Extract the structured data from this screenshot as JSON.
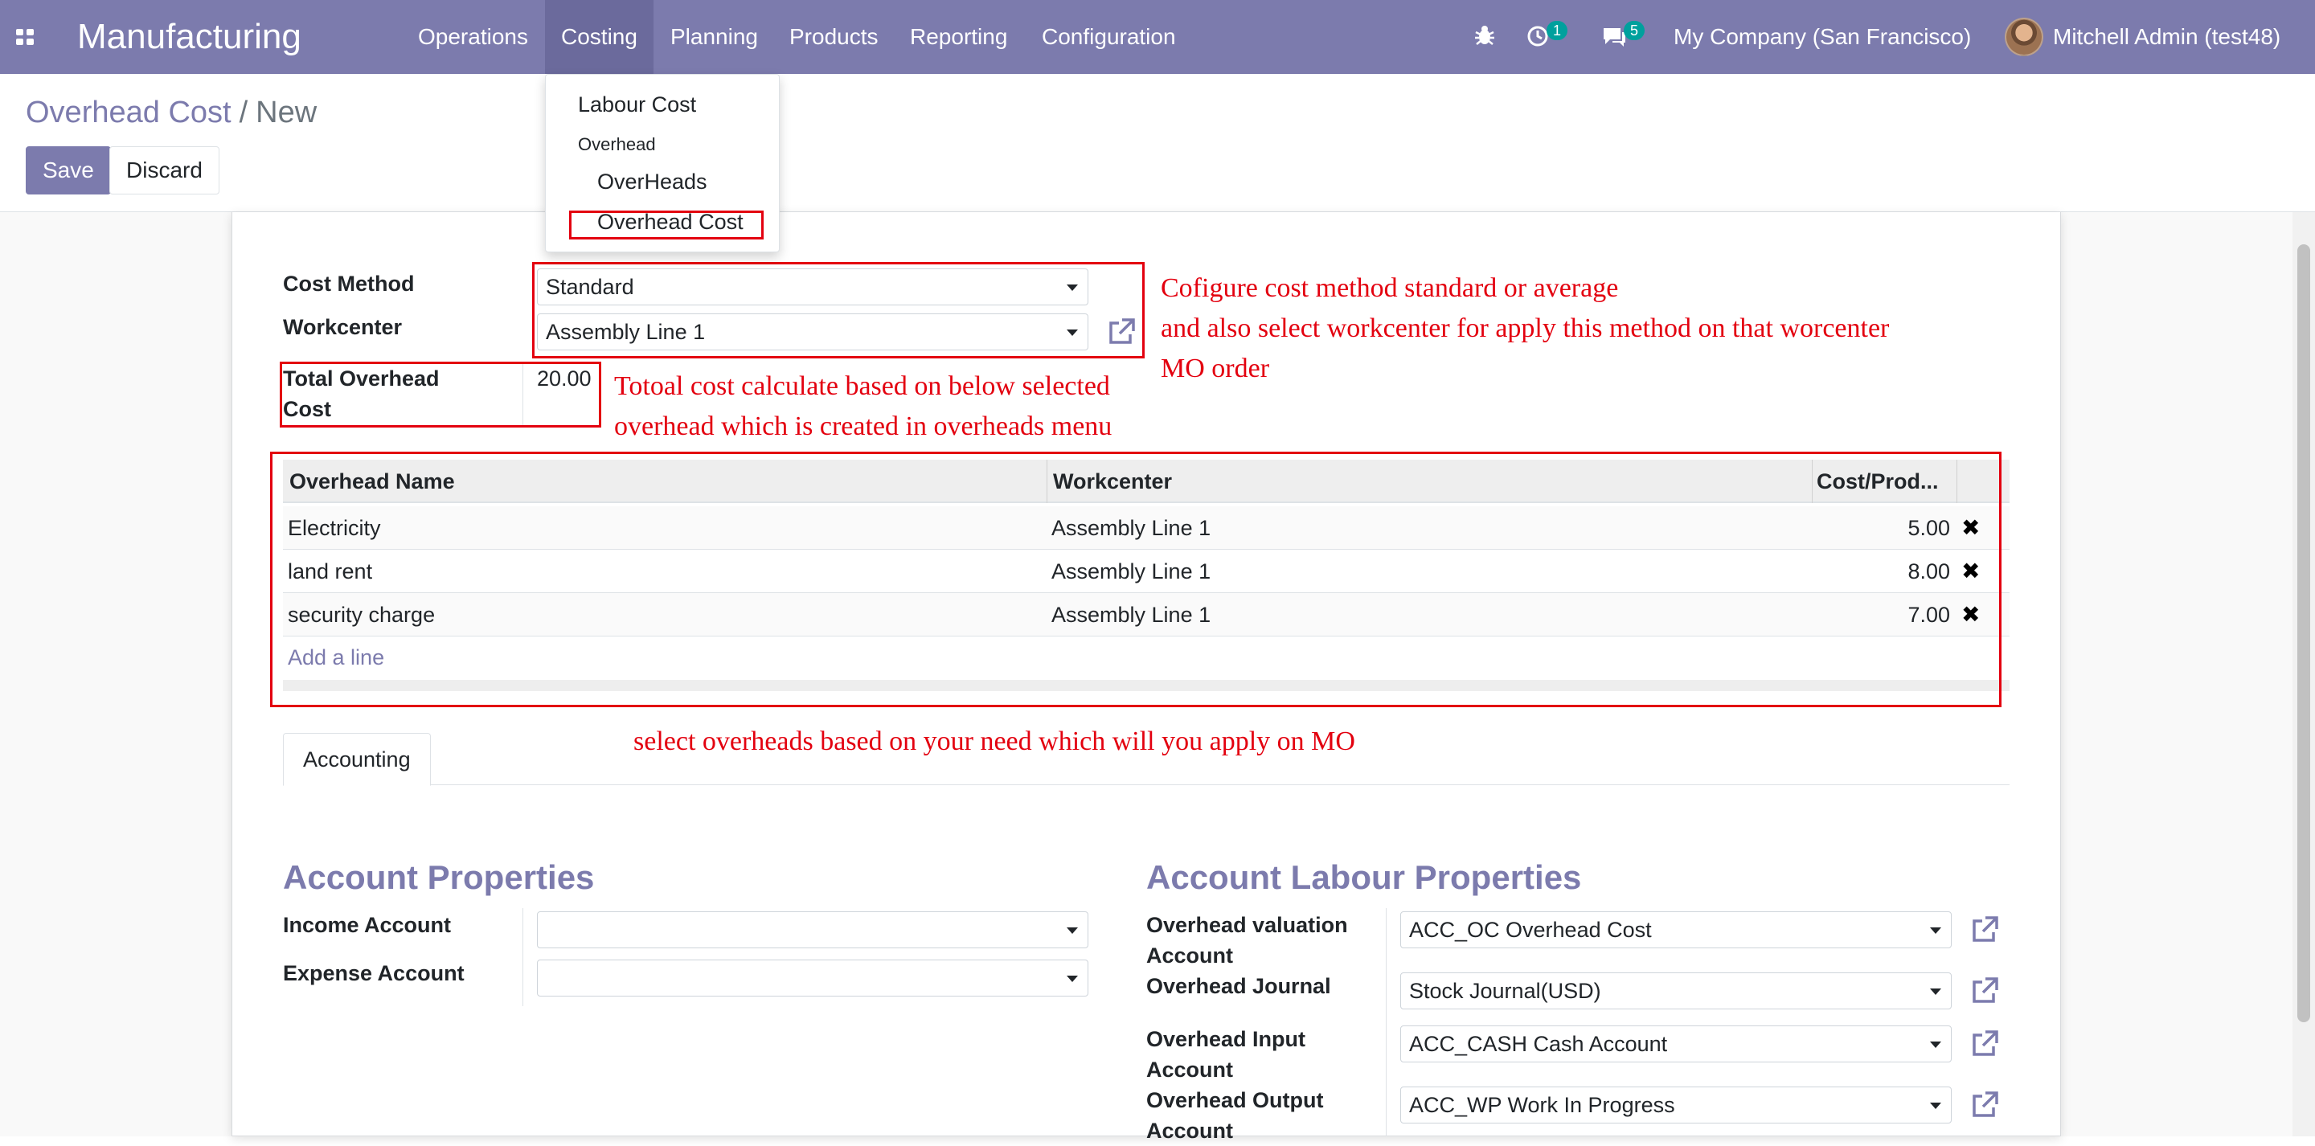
{
  "navbar": {
    "app_name": "Manufacturing",
    "menu": [
      "Operations",
      "Costing",
      "Planning",
      "Products",
      "Reporting",
      "Configuration"
    ],
    "activities_count": "1",
    "messages_count": "5",
    "company": "My Company (San Francisco)",
    "user": "Mitchell Admin (test48)"
  },
  "dropdown": {
    "labour_cost": "Labour Cost",
    "overhead_header": "Overhead",
    "overheads": "OverHeads",
    "overhead_cost": "Overhead Cost"
  },
  "breadcrumb": {
    "parent": "Overhead Cost",
    "separator": "/",
    "current": "New"
  },
  "buttons": {
    "save": "Save",
    "discard": "Discard"
  },
  "form": {
    "cost_method_label": "Cost Method",
    "cost_method_value": "Standard",
    "workcenter_label": "Workcenter",
    "workcenter_value": "Assembly Line 1",
    "total_label_line1": "Total Overhead",
    "total_label_line2": "Cost",
    "total_value": "20.00"
  },
  "table": {
    "headers": [
      "Overhead Name",
      "Workcenter",
      "Cost/Prod..."
    ],
    "rows": [
      {
        "name": "Electricity",
        "workcenter": "Assembly Line 1",
        "cost": "5.00"
      },
      {
        "name": "land rent",
        "workcenter": "Assembly Line 1",
        "cost": "8.00"
      },
      {
        "name": "security charge",
        "workcenter": "Assembly Line 1",
        "cost": "7.00"
      }
    ],
    "add_line": "Add a line"
  },
  "annotations": {
    "cost_method_1": "Cofigure cost method standard or average",
    "cost_method_2": "and also select workcenter for apply this method on that worcenter",
    "cost_method_3": "MO order",
    "total_1": "Totoal cost calculate based on below selected",
    "total_2": "overhead which is created in overheads menu",
    "overheads": "select overheads based on your need which will you apply on MO"
  },
  "tabs": {
    "accounting": "Accounting"
  },
  "account_properties": {
    "title": "Account Properties",
    "income_label": "Income Account",
    "income_value": "",
    "expense_label": "Expense Account",
    "expense_value": ""
  },
  "labour_properties": {
    "title": "Account Labour Properties",
    "valuation_label_1": "Overhead valuation",
    "valuation_label_2": "Account",
    "valuation_value": "ACC_OC Overhead Cost",
    "journal_label": "Overhead Journal",
    "journal_value": "Stock Journal(USD)",
    "input_label_1": "Overhead Input",
    "input_label_2": "Account",
    "input_value": "ACC_CASH Cash Account",
    "output_label_1": "Overhead Output",
    "output_label_2": "Account",
    "output_value": "ACC_WP Work In Progress"
  },
  "colors": {
    "brand": "#7c7bad",
    "annotation": "#e3000f",
    "badge": "#00a09d"
  }
}
